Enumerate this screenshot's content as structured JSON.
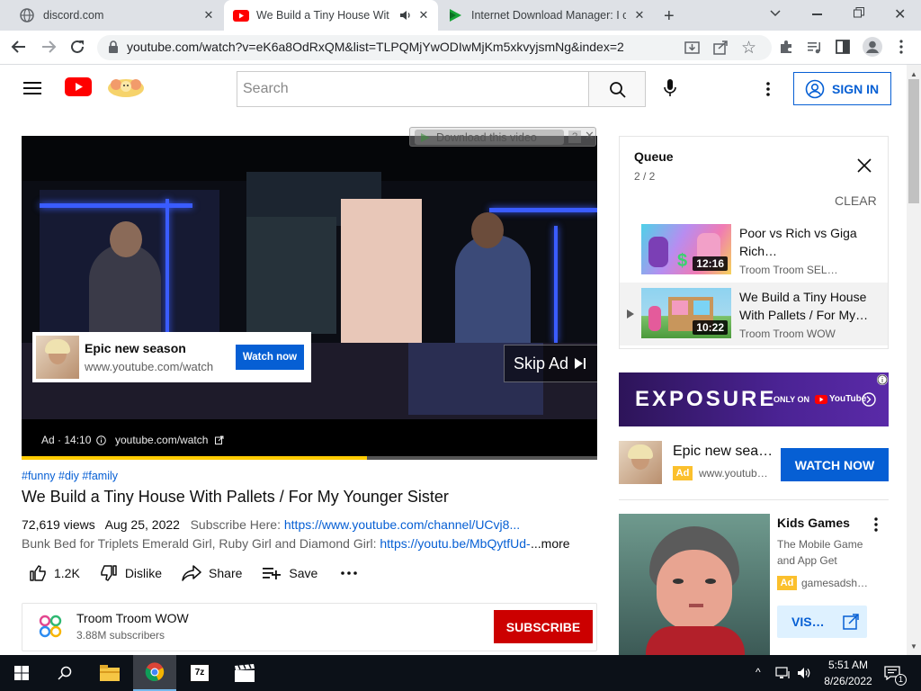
{
  "tabs": [
    {
      "title": "discord.com",
      "icon": "globe-icon"
    },
    {
      "title": "We Build a Tiny House With Pall",
      "icon": "youtube-icon",
      "audio": "speaker-icon"
    },
    {
      "title": "Internet Download Manager: I ca",
      "icon": "idm-icon"
    }
  ],
  "address_bar": {
    "url": "youtube.com/watch?v=eK6a8OdRxQM&list=TLPQMjYwODIwMjKm5xkvyjsmNg&index=2"
  },
  "masthead": {
    "search_placeholder": "Search",
    "sign_in": "SIGN IN"
  },
  "player": {
    "download_overlay": "Download this video",
    "download_help": "?",
    "ad_card": {
      "title": "Epic new season",
      "url": "www.youtube.com/watch",
      "button": "Watch now"
    },
    "skip": "Skip Ad",
    "ad_info": "Ad · 14:10",
    "ad_url": "youtube.com/watch",
    "progress_fraction": 0.6
  },
  "video": {
    "hashtags": "#funny #diy #family",
    "title": "We Build a Tiny House With Pallets / For My Younger Sister",
    "views": "72,619 views",
    "date": "Aug 25, 2022",
    "subscribe_here": "Subscribe Here:",
    "channel_link": "https://www.youtube.com/channel/UCvj8...",
    "desc_line2": "Bunk Bed for Triplets Emerald Girl, Ruby Girl and Diamond Girl:",
    "desc_link2": "https://youtu.be/MbQytfUd-",
    "more": "...more",
    "actions": {
      "like": "1.2K",
      "dislike": "Dislike",
      "share": "Share",
      "save": "Save"
    }
  },
  "channel": {
    "name": "Troom Troom WOW",
    "subscribers": "3.88M subscribers",
    "subscribe": "SUBSCRIBE"
  },
  "queue": {
    "title": "Queue",
    "position": "2 / 2",
    "clear": "CLEAR",
    "items": [
      {
        "title": "Poor vs Rich vs Giga Rich…",
        "channel": "Troom Troom SEL…",
        "duration": "12:16"
      },
      {
        "title": "We Build a Tiny House With Pallets / For My…",
        "channel": "Troom Troom WOW",
        "duration": "10:22"
      }
    ]
  },
  "banner": {
    "brand": "EXPOSURE",
    "only_on": "ONLY ON",
    "youtube": "YouTube"
  },
  "ad2": {
    "title": "Epic new sea…",
    "badge": "Ad",
    "url": "www.youtub…",
    "button": "WATCH NOW"
  },
  "ad3": {
    "title": "Kids Games",
    "subtitle": "The Mobile Game and App Get",
    "badge": "Ad",
    "domain": "gamesadsh…",
    "button": "VIS…"
  },
  "taskbar": {
    "time": "5:51 AM",
    "date": "8/26/2022",
    "notifications": "1"
  },
  "colors": {
    "youtube_red": "#ff0000",
    "link_blue": "#065fd4",
    "subscribe_red": "#cc0000",
    "ad_yellow": "#ffcc00"
  }
}
